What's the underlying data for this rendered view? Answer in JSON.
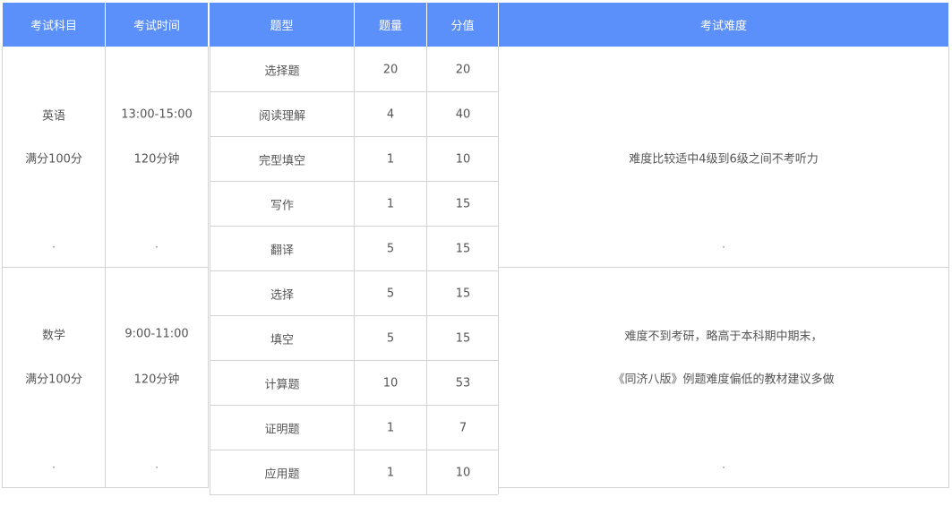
{
  "headers": {
    "subject": "考试科目",
    "time": "考试时间",
    "question_type": "题型",
    "count": "题量",
    "score": "分值",
    "difficulty": "考试难度"
  },
  "sections": [
    {
      "subject": "英语",
      "full_score": "满分100分",
      "time_range": "13:00-15:00",
      "duration": "120分钟",
      "trailing_mark": "·",
      "difficulty_lines": [
        "难度比较适中4级到6级之间不考听力"
      ],
      "rows": [
        {
          "type": "选择题",
          "count": "20",
          "score": "20"
        },
        {
          "type": "阅读理解",
          "count": "4",
          "score": "40"
        },
        {
          "type": "完型填空",
          "count": "1",
          "score": "10"
        },
        {
          "type": "写作",
          "count": "1",
          "score": "15"
        },
        {
          "type": "翻译",
          "count": "5",
          "score": "15"
        }
      ]
    },
    {
      "subject": "数学",
      "full_score": "满分100分",
      "time_range": "9:00-11:00",
      "duration": "120分钟",
      "trailing_mark": "·",
      "difficulty_lines": [
        "难度不到考研，略高于本科期中期末，",
        "《同济八版》例题难度偏低的教材建议多做"
      ],
      "rows": [
        {
          "type": "选择",
          "count": "5",
          "score": "15"
        },
        {
          "type": "填空",
          "count": "5",
          "score": "15"
        },
        {
          "type": "计算题",
          "count": "10",
          "score": "53"
        },
        {
          "type": "证明题",
          "count": "1",
          "score": "7"
        },
        {
          "type": "应用题",
          "count": "1",
          "score": "10"
        }
      ]
    }
  ]
}
